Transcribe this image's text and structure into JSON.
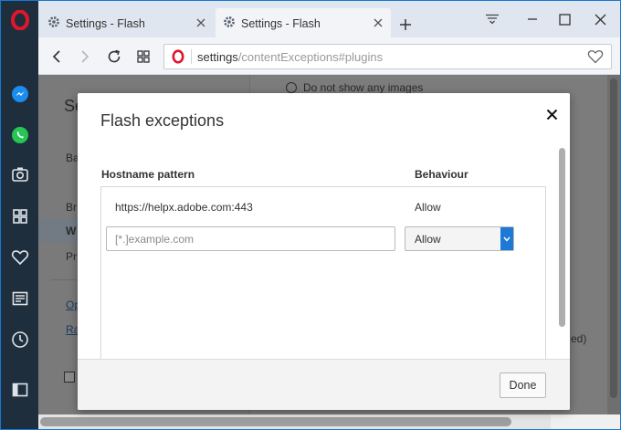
{
  "tabs": [
    {
      "title": "Settings - Flash",
      "active": false
    },
    {
      "title": "Settings - Flash",
      "active": true
    }
  ],
  "address": {
    "host": "settings",
    "path": "/contentExceptions#plugins"
  },
  "background_page": {
    "radio_label": "Do not show any images",
    "side_partial": [
      "Se",
      "Ba",
      "Br",
      "W",
      "Pr",
      "Op",
      "Ra"
    ],
    "right_partial": "ed)"
  },
  "dialog": {
    "title": "Flash exceptions",
    "col_hostname": "Hostname pattern",
    "col_behaviour": "Behaviour",
    "rows": [
      {
        "host": "https://helpx.adobe.com:443",
        "behaviour": "Allow"
      }
    ],
    "new_entry_placeholder": "[*.]example.com",
    "new_entry_behaviour": "Allow",
    "done_label": "Done"
  },
  "colors": {
    "accent": "#1c7ad6",
    "sidebar": "#1f2e3c",
    "opera_red": "#e2162b"
  }
}
